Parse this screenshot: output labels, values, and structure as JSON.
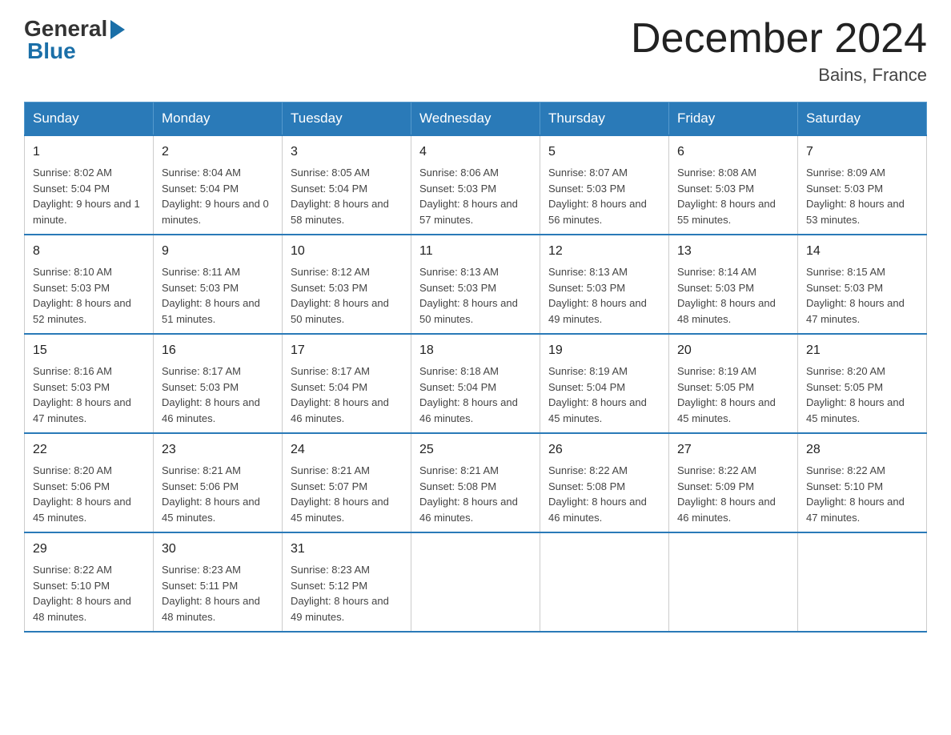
{
  "logo": {
    "general": "General",
    "blue": "Blue"
  },
  "title": {
    "month": "December 2024",
    "location": "Bains, France"
  },
  "days_header": [
    "Sunday",
    "Monday",
    "Tuesday",
    "Wednesday",
    "Thursday",
    "Friday",
    "Saturday"
  ],
  "weeks": [
    [
      {
        "num": "1",
        "sunrise": "8:02 AM",
        "sunset": "5:04 PM",
        "daylight": "9 hours and 1 minute."
      },
      {
        "num": "2",
        "sunrise": "8:04 AM",
        "sunset": "5:04 PM",
        "daylight": "9 hours and 0 minutes."
      },
      {
        "num": "3",
        "sunrise": "8:05 AM",
        "sunset": "5:04 PM",
        "daylight": "8 hours and 58 minutes."
      },
      {
        "num": "4",
        "sunrise": "8:06 AM",
        "sunset": "5:03 PM",
        "daylight": "8 hours and 57 minutes."
      },
      {
        "num": "5",
        "sunrise": "8:07 AM",
        "sunset": "5:03 PM",
        "daylight": "8 hours and 56 minutes."
      },
      {
        "num": "6",
        "sunrise": "8:08 AM",
        "sunset": "5:03 PM",
        "daylight": "8 hours and 55 minutes."
      },
      {
        "num": "7",
        "sunrise": "8:09 AM",
        "sunset": "5:03 PM",
        "daylight": "8 hours and 53 minutes."
      }
    ],
    [
      {
        "num": "8",
        "sunrise": "8:10 AM",
        "sunset": "5:03 PM",
        "daylight": "8 hours and 52 minutes."
      },
      {
        "num": "9",
        "sunrise": "8:11 AM",
        "sunset": "5:03 PM",
        "daylight": "8 hours and 51 minutes."
      },
      {
        "num": "10",
        "sunrise": "8:12 AM",
        "sunset": "5:03 PM",
        "daylight": "8 hours and 50 minutes."
      },
      {
        "num": "11",
        "sunrise": "8:13 AM",
        "sunset": "5:03 PM",
        "daylight": "8 hours and 50 minutes."
      },
      {
        "num": "12",
        "sunrise": "8:13 AM",
        "sunset": "5:03 PM",
        "daylight": "8 hours and 49 minutes."
      },
      {
        "num": "13",
        "sunrise": "8:14 AM",
        "sunset": "5:03 PM",
        "daylight": "8 hours and 48 minutes."
      },
      {
        "num": "14",
        "sunrise": "8:15 AM",
        "sunset": "5:03 PM",
        "daylight": "8 hours and 47 minutes."
      }
    ],
    [
      {
        "num": "15",
        "sunrise": "8:16 AM",
        "sunset": "5:03 PM",
        "daylight": "8 hours and 47 minutes."
      },
      {
        "num": "16",
        "sunrise": "8:17 AM",
        "sunset": "5:03 PM",
        "daylight": "8 hours and 46 minutes."
      },
      {
        "num": "17",
        "sunrise": "8:17 AM",
        "sunset": "5:04 PM",
        "daylight": "8 hours and 46 minutes."
      },
      {
        "num": "18",
        "sunrise": "8:18 AM",
        "sunset": "5:04 PM",
        "daylight": "8 hours and 46 minutes."
      },
      {
        "num": "19",
        "sunrise": "8:19 AM",
        "sunset": "5:04 PM",
        "daylight": "8 hours and 45 minutes."
      },
      {
        "num": "20",
        "sunrise": "8:19 AM",
        "sunset": "5:05 PM",
        "daylight": "8 hours and 45 minutes."
      },
      {
        "num": "21",
        "sunrise": "8:20 AM",
        "sunset": "5:05 PM",
        "daylight": "8 hours and 45 minutes."
      }
    ],
    [
      {
        "num": "22",
        "sunrise": "8:20 AM",
        "sunset": "5:06 PM",
        "daylight": "8 hours and 45 minutes."
      },
      {
        "num": "23",
        "sunrise": "8:21 AM",
        "sunset": "5:06 PM",
        "daylight": "8 hours and 45 minutes."
      },
      {
        "num": "24",
        "sunrise": "8:21 AM",
        "sunset": "5:07 PM",
        "daylight": "8 hours and 45 minutes."
      },
      {
        "num": "25",
        "sunrise": "8:21 AM",
        "sunset": "5:08 PM",
        "daylight": "8 hours and 46 minutes."
      },
      {
        "num": "26",
        "sunrise": "8:22 AM",
        "sunset": "5:08 PM",
        "daylight": "8 hours and 46 minutes."
      },
      {
        "num": "27",
        "sunrise": "8:22 AM",
        "sunset": "5:09 PM",
        "daylight": "8 hours and 46 minutes."
      },
      {
        "num": "28",
        "sunrise": "8:22 AM",
        "sunset": "5:10 PM",
        "daylight": "8 hours and 47 minutes."
      }
    ],
    [
      {
        "num": "29",
        "sunrise": "8:22 AM",
        "sunset": "5:10 PM",
        "daylight": "8 hours and 48 minutes."
      },
      {
        "num": "30",
        "sunrise": "8:23 AM",
        "sunset": "5:11 PM",
        "daylight": "8 hours and 48 minutes."
      },
      {
        "num": "31",
        "sunrise": "8:23 AM",
        "sunset": "5:12 PM",
        "daylight": "8 hours and 49 minutes."
      },
      null,
      null,
      null,
      null
    ]
  ]
}
